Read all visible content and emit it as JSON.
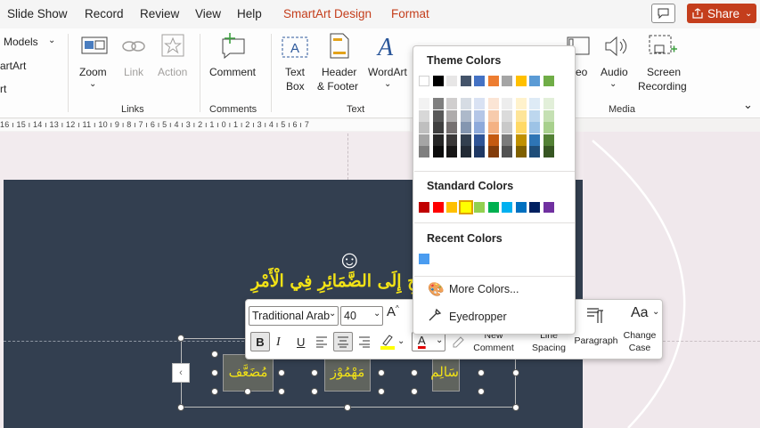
{
  "tabs": [
    "Slide Show",
    "Record",
    "Review",
    "View",
    "Help",
    "SmartArt Design",
    "Format"
  ],
  "tabbar": {
    "share_label": "Share",
    "accent": "#c43e1c"
  },
  "ribbon": {
    "left_items": [
      "Models",
      "artArt",
      "rt"
    ],
    "buttons": {
      "zoom": "Zoom",
      "link": "Link",
      "action": "Action",
      "comment": "Comment",
      "textbox_1": "Text",
      "textbox_2": "Box",
      "header_1": "Header",
      "header_2": "& Footer",
      "wordart": "WordArt",
      "video": "eo",
      "audio": "Audio",
      "screenrec_1": "Screen",
      "screenrec_2": "Recording"
    },
    "groups": {
      "links": "Links",
      "comments": "Comments",
      "text": "Text",
      "media": "Media"
    }
  },
  "ruler": {
    "text": "16 ı 15 ı 14 ı 13 ı 12 ı 11 ı 10 ı 9 ı 8 ı 7 ı 6 ı 5 ı 4 ı 3 ı 2 ı 1 ı 0 ı 1 ı 2 ı 3 ı 4 ı 5 ı 6 ı 7"
  },
  "slide": {
    "title_arabic": "الصَّحِيْحِ إِلَى الضَّمَائِرِ فِي الْأَمْرِ",
    "shapes": [
      "مُضَعَّف",
      "مَهْمُوْز",
      "سَالِم"
    ],
    "colors": {
      "background": "#333f50",
      "text": "#f2e216"
    }
  },
  "mini_toolbar": {
    "font_name": "Traditional Arab",
    "font_size": "40",
    "buttons": {
      "bold": "B",
      "italic": "I",
      "underline": "U",
      "new_comment_1": "New",
      "new_comment_2": "Comment",
      "line_spacing_1": "Line",
      "line_spacing_2": "Spacing",
      "paragraph": "Paragraph",
      "change_case_1": "Change",
      "change_case_2": "Case",
      "aa": "Aa"
    }
  },
  "palette": {
    "theme_title": "Theme Colors",
    "standard_title": "Standard Colors",
    "recent_title": "Recent Colors",
    "more_colors": "More Colors...",
    "eyedropper": "Eyedropper",
    "theme_top_row": [
      "#ffffff",
      "#000000",
      "#e7e6e6",
      "#44546a",
      "#4472c4",
      "#ed7d31",
      "#a5a5a5",
      "#ffc000",
      "#5b9bd5",
      "#70ad47"
    ],
    "theme_shades": [
      [
        "#f2f2f2",
        "#7f7f7f",
        "#d0cece",
        "#d6dce4",
        "#d9e2f3",
        "#fbe5d5",
        "#ededed",
        "#fff2cc",
        "#deebf6",
        "#e2efd9"
      ],
      [
        "#d8d8d8",
        "#595959",
        "#aeabab",
        "#adb9ca",
        "#b4c6e7",
        "#f7cbac",
        "#dbdbdb",
        "#fee599",
        "#bdd7ee",
        "#c5e0b3"
      ],
      [
        "#bfbfbf",
        "#3f3f3f",
        "#757070",
        "#8496b0",
        "#8eaadb",
        "#f4b183",
        "#c9c9c9",
        "#ffd966",
        "#9dc3e6",
        "#a8d08d"
      ],
      [
        "#a5a5a5",
        "#262626",
        "#3a3838",
        "#323f4f",
        "#2f5496",
        "#c55a11",
        "#7b7b7b",
        "#bf9000",
        "#2e75b5",
        "#538135"
      ],
      [
        "#7f7f7f",
        "#0c0c0c",
        "#171616",
        "#222a35",
        "#1f3864",
        "#833c0b",
        "#525252",
        "#7f6000",
        "#1f4e79",
        "#375623"
      ]
    ],
    "standard": [
      "#c00000",
      "#ff0000",
      "#ffc000",
      "#ffff00",
      "#92d050",
      "#00b050",
      "#00b0f0",
      "#0070c0",
      "#002060",
      "#7030a0"
    ],
    "recent": [
      "#4a9cf0"
    ]
  }
}
